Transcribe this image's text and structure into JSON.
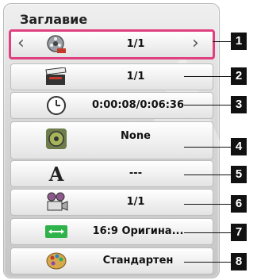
{
  "menu": {
    "title": "Заглавие",
    "rows": [
      {
        "icon": "film-reel-icon",
        "value": "1/1",
        "number": "1"
      },
      {
        "icon": "clapperboard-icon",
        "value": "1/1",
        "number": "2"
      },
      {
        "icon": "clock-icon",
        "value": "0:00:08/0:06:36",
        "number": "3"
      },
      {
        "icon": "speaker-icon",
        "value": "None",
        "number": "4"
      },
      {
        "icon": "subtitle-letter-icon",
        "value": "---",
        "number": "5"
      },
      {
        "icon": "camera-icon",
        "value": "1/1",
        "number": "6"
      },
      {
        "icon": "aspect-ratio-icon",
        "value": "16:9 Оригина...",
        "number": "7"
      },
      {
        "icon": "palette-icon",
        "value": "Стандартен",
        "number": "8"
      }
    ]
  },
  "colors": {
    "selection": "#e0407f"
  }
}
